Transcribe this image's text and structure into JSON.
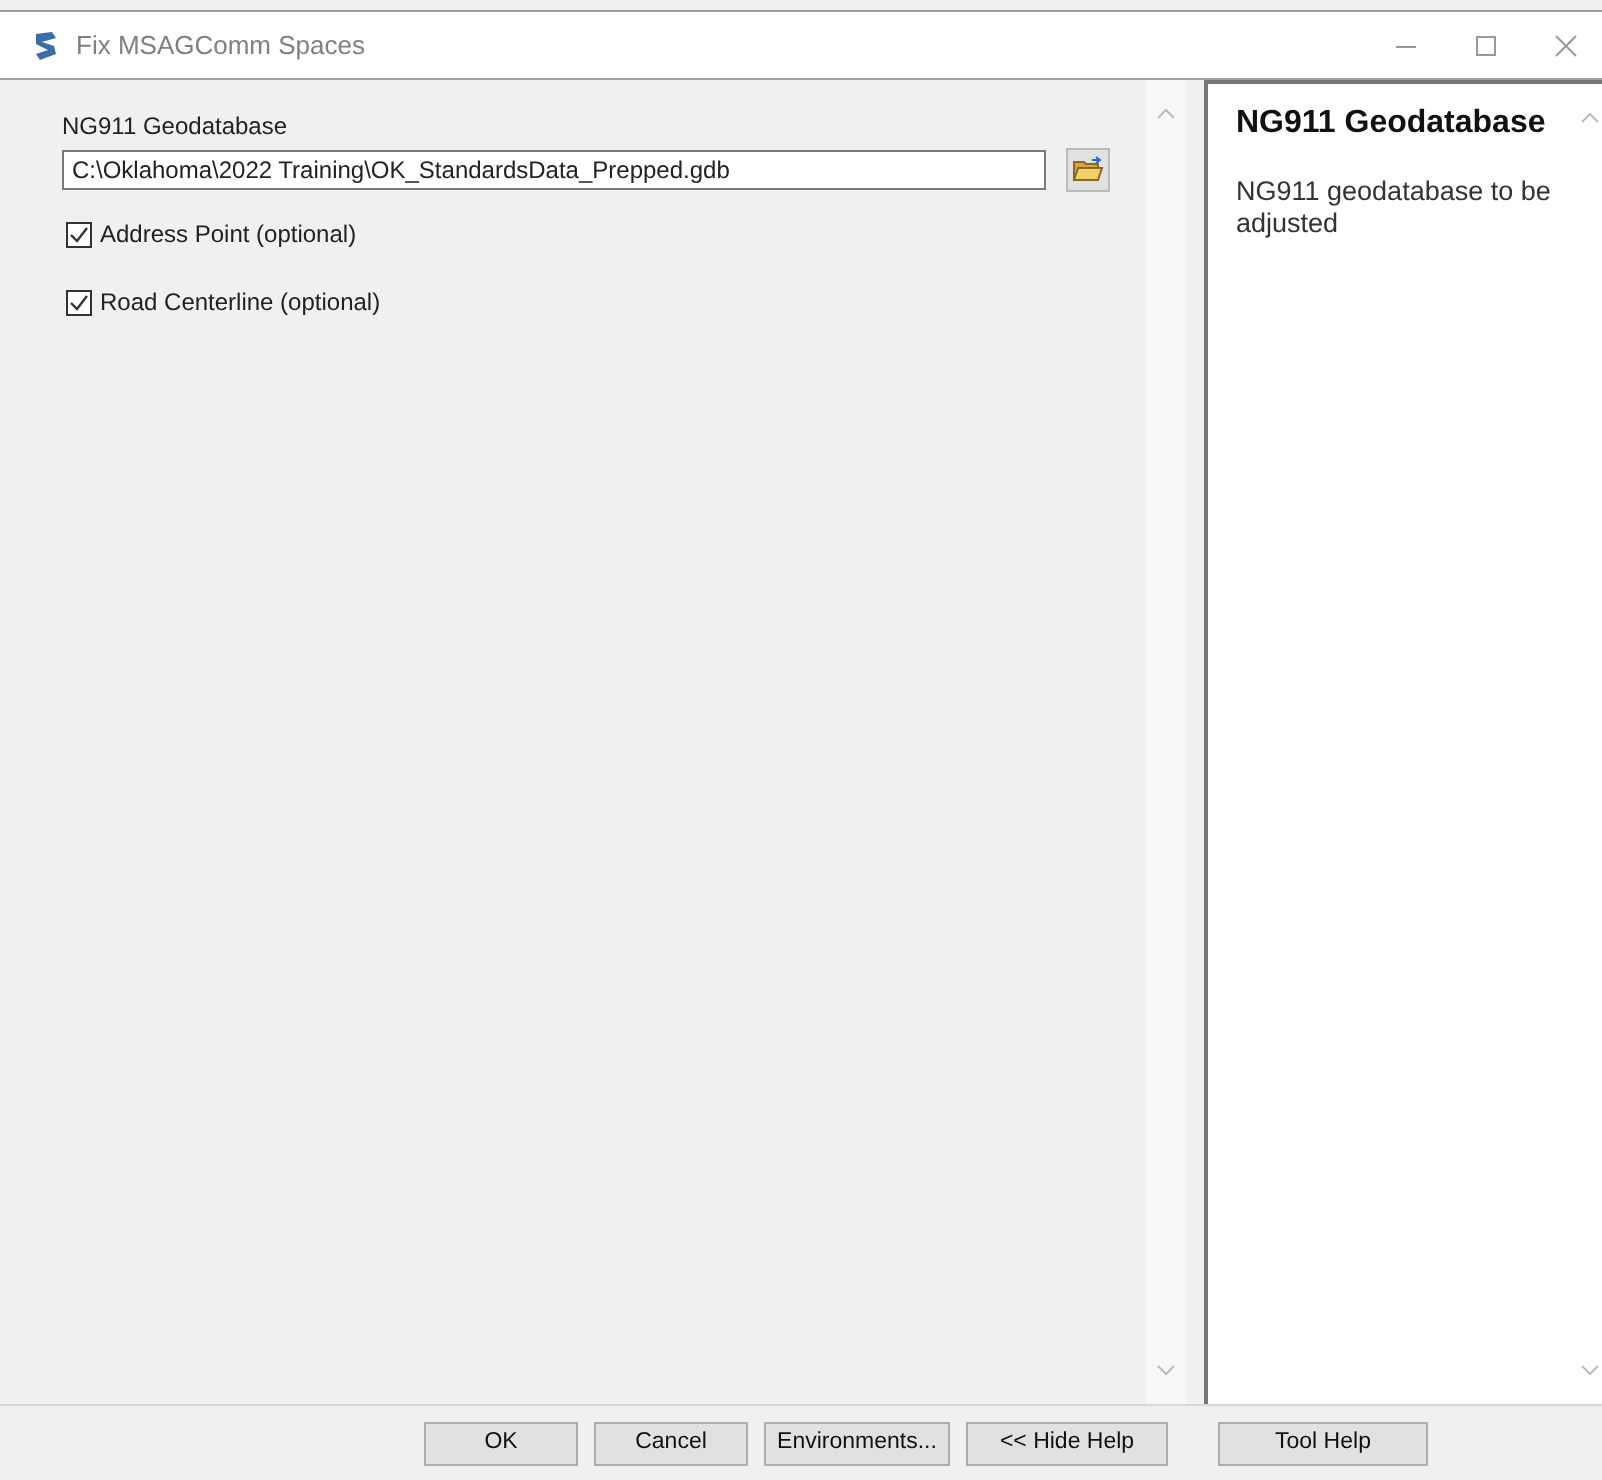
{
  "window": {
    "title": "Fix MSAGComm Spaces"
  },
  "parameters": [
    {
      "kind": "path",
      "label": "NG911 Geodatabase",
      "value": "C:\\Oklahoma\\2022 Training\\OK_StandardsData_Prepped.gdb"
    },
    {
      "kind": "checkbox",
      "label": "Address Point (optional)",
      "checked": true
    },
    {
      "kind": "checkbox",
      "label": "Road Centerline (optional)",
      "checked": true
    }
  ],
  "help": {
    "title": "NG911 Geodatabase",
    "text": "NG911 geodatabase to be adjusted"
  },
  "buttons": [
    "OK",
    "Cancel",
    "Environments...",
    "<< Hide Help",
    "Tool Help"
  ]
}
